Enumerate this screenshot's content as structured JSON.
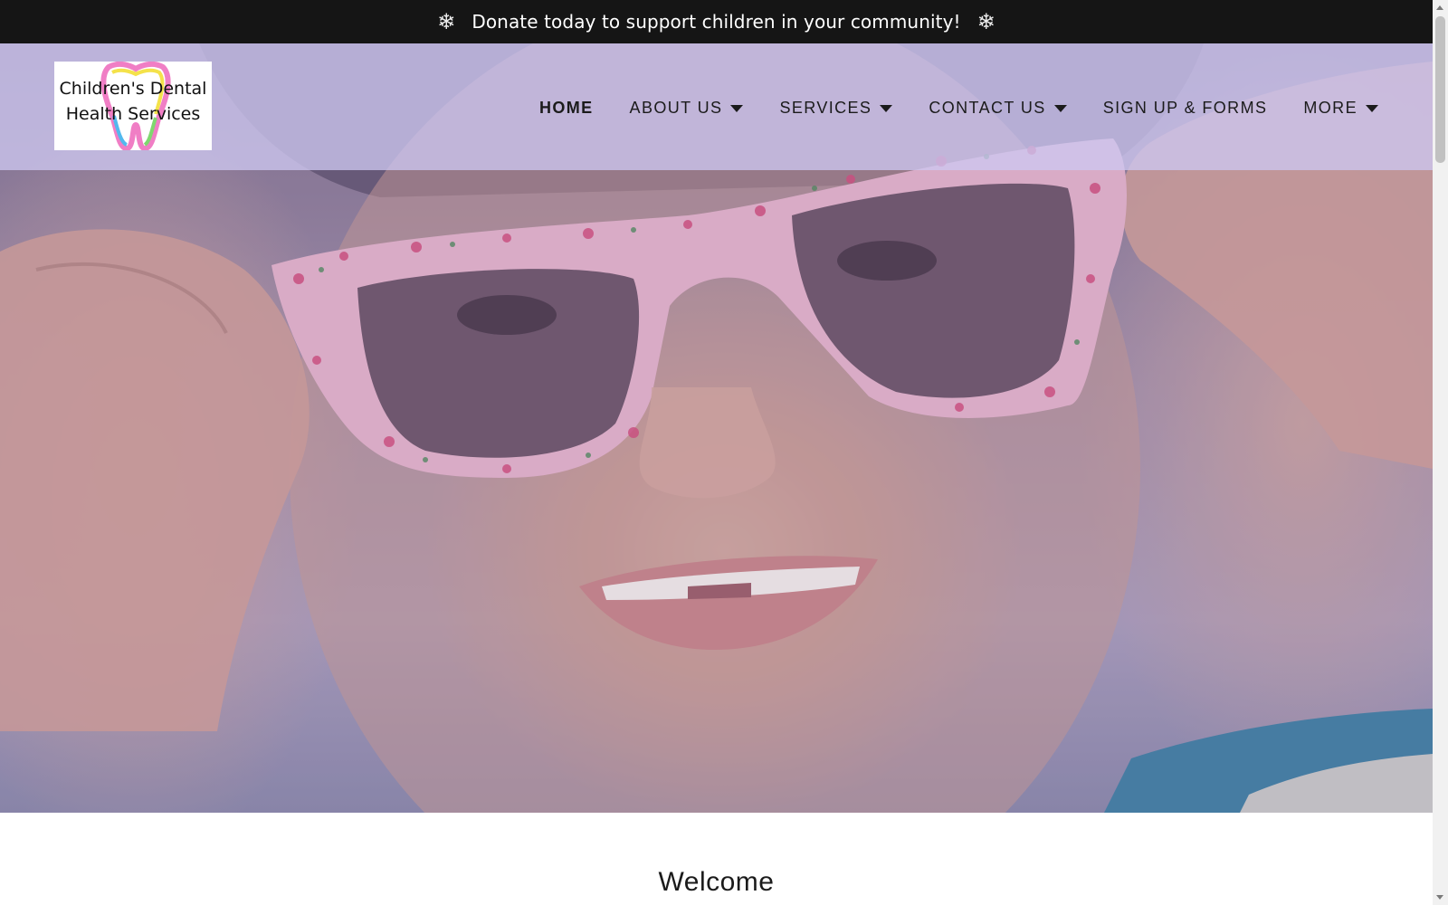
{
  "announcement": {
    "text": "Donate today to support children in your community!",
    "icon_left": "❄",
    "icon_right": "❄",
    "icon_name": "snowflake-icon"
  },
  "logo": {
    "line1": "Children's Dental",
    "line2": "Health Services",
    "tooth_colors": [
      "#f07ec5",
      "#f4e24a",
      "#52b9ee",
      "#7fd86f"
    ]
  },
  "nav": {
    "items": [
      {
        "label": "HOME",
        "active": true,
        "has_dropdown": false
      },
      {
        "label": "ABOUT US",
        "active": false,
        "has_dropdown": true
      },
      {
        "label": "SERVICES",
        "active": false,
        "has_dropdown": true
      },
      {
        "label": "CONTACT US",
        "active": false,
        "has_dropdown": true
      },
      {
        "label": "SIGN UP & FORMS",
        "active": false,
        "has_dropdown": false
      },
      {
        "label": "MORE",
        "active": false,
        "has_dropdown": true
      }
    ]
  },
  "hero": {
    "image_subject": "child-with-pink-floral-sunglasses"
  },
  "main": {
    "heading": "Welcome"
  },
  "colors": {
    "announce_bg": "#151515",
    "header_overlay": "#cdc6f0",
    "text_dark": "#1b1b1b"
  }
}
